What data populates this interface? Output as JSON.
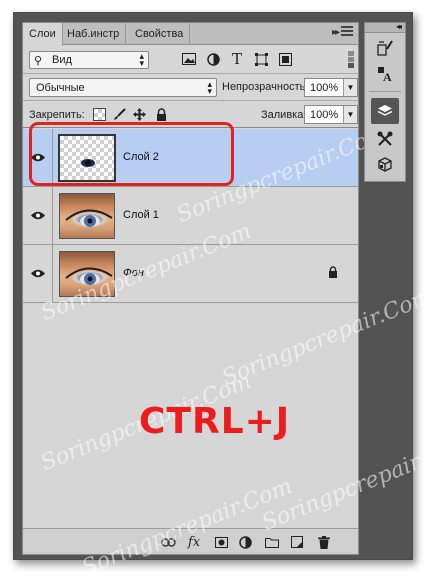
{
  "tabs": [
    {
      "label": "Слои",
      "active": true
    },
    {
      "label": "Наб.инстр",
      "active": false
    },
    {
      "label": "Свойства",
      "active": false
    }
  ],
  "filter": {
    "kind_label": "Вид"
  },
  "blend": {
    "mode": "Обычные"
  },
  "opacity": {
    "label": "Непрозрачность:",
    "value": "100%"
  },
  "lock": {
    "label": "Закрепить:"
  },
  "fill": {
    "label": "Заливка:",
    "value": "100%"
  },
  "layers": [
    {
      "name": "Слой 2",
      "selected": true,
      "visible": true,
      "thumbnail": "transparent-eye",
      "locked": false
    },
    {
      "name": "Слой 1",
      "selected": false,
      "visible": true,
      "thumbnail": "eye-photo",
      "locked": false
    },
    {
      "name": "Фон",
      "selected": false,
      "visible": true,
      "thumbnail": "eye-photo",
      "locked": true
    }
  ],
  "bottom_icons": [
    "link-icon",
    "fx-icon",
    "mask-icon",
    "adjustment-icon",
    "folder-icon",
    "new-layer-icon",
    "trash-icon"
  ],
  "dock_icons": [
    "brush-preset-icon",
    "character-icon",
    "layers-icon",
    "tools-icon",
    "3d-icon"
  ],
  "overlay": {
    "shortcut": "CTRL+J"
  },
  "watermark": "Soringpcrepair.Com",
  "colors": {
    "selected_row": "#b8cdf2",
    "highlight": "#e0231c",
    "shortcut_text": "#ee1c1c"
  }
}
